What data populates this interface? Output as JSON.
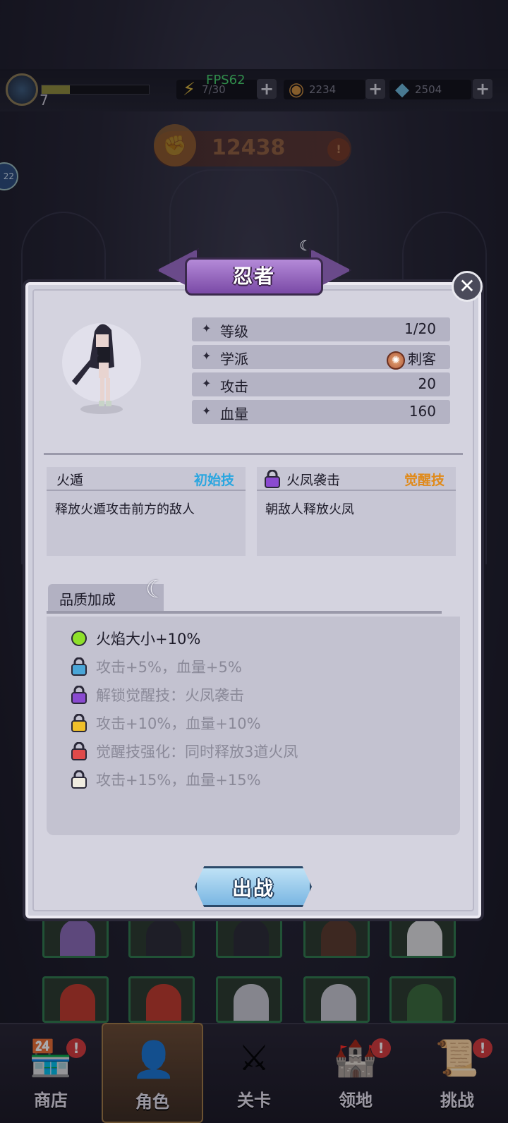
{
  "hud": {
    "level": "7",
    "energy": "7/30",
    "fps": "FPS62",
    "coins": "2234",
    "gems": "2504",
    "power": "12438",
    "side_badge": "22"
  },
  "dialog": {
    "title": "忍者",
    "stats": [
      {
        "label": "等级",
        "value": "1/20"
      },
      {
        "label": "学派",
        "value": "刺客"
      },
      {
        "label": "攻击",
        "value": "20"
      },
      {
        "label": "血量",
        "value": "160"
      }
    ],
    "skills": [
      {
        "name": "火遁",
        "tag": "初始技",
        "tag_color": "#2aa6e0",
        "desc": "释放火遁攻击前方的敌人"
      },
      {
        "name": "火凤袭击",
        "tag": "觉醒技",
        "tag_color": "#e08a1a",
        "desc": "朝敌人释放火凤"
      }
    ],
    "quality_title": "品质加成",
    "quality": [
      {
        "text": "火焰大小+10%",
        "icon": "green-dot-icon",
        "color": "#1e1c2a",
        "icon_color": "#8ee02a"
      },
      {
        "text": "攻击+5%，血量+5%",
        "icon": "lock-icon",
        "color": "#8a8998",
        "icon_color": "#4aa6d8"
      },
      {
        "text": "解锁觉醒技：火凤袭击",
        "icon": "lock-icon",
        "color": "#8a8998",
        "icon_color": "#8a4ad0"
      },
      {
        "text": "攻击+10%，血量+10%",
        "icon": "lock-icon",
        "color": "#8a8998",
        "icon_color": "#f0c02a"
      },
      {
        "text": "觉醒技强化：同时释放3道火凤",
        "icon": "lock-icon",
        "color": "#8a8998",
        "icon_color": "#e04a4a"
      },
      {
        "text": "攻击+15%，血量+15%",
        "icon": "lock-icon",
        "color": "#8a8998",
        "icon_color": "#f0ece0"
      }
    ],
    "sortie_label": "出战"
  },
  "nav": [
    {
      "label": "商店",
      "icon": "shop-icon",
      "badge": "!"
    },
    {
      "label": "角色",
      "icon": "hero-icon",
      "badge": ""
    },
    {
      "label": "关卡",
      "icon": "swords-icon",
      "badge": ""
    },
    {
      "label": "领地",
      "icon": "castle-icon",
      "badge": "!"
    },
    {
      "label": "挑战",
      "icon": "scroll-icon",
      "badge": "!"
    }
  ]
}
